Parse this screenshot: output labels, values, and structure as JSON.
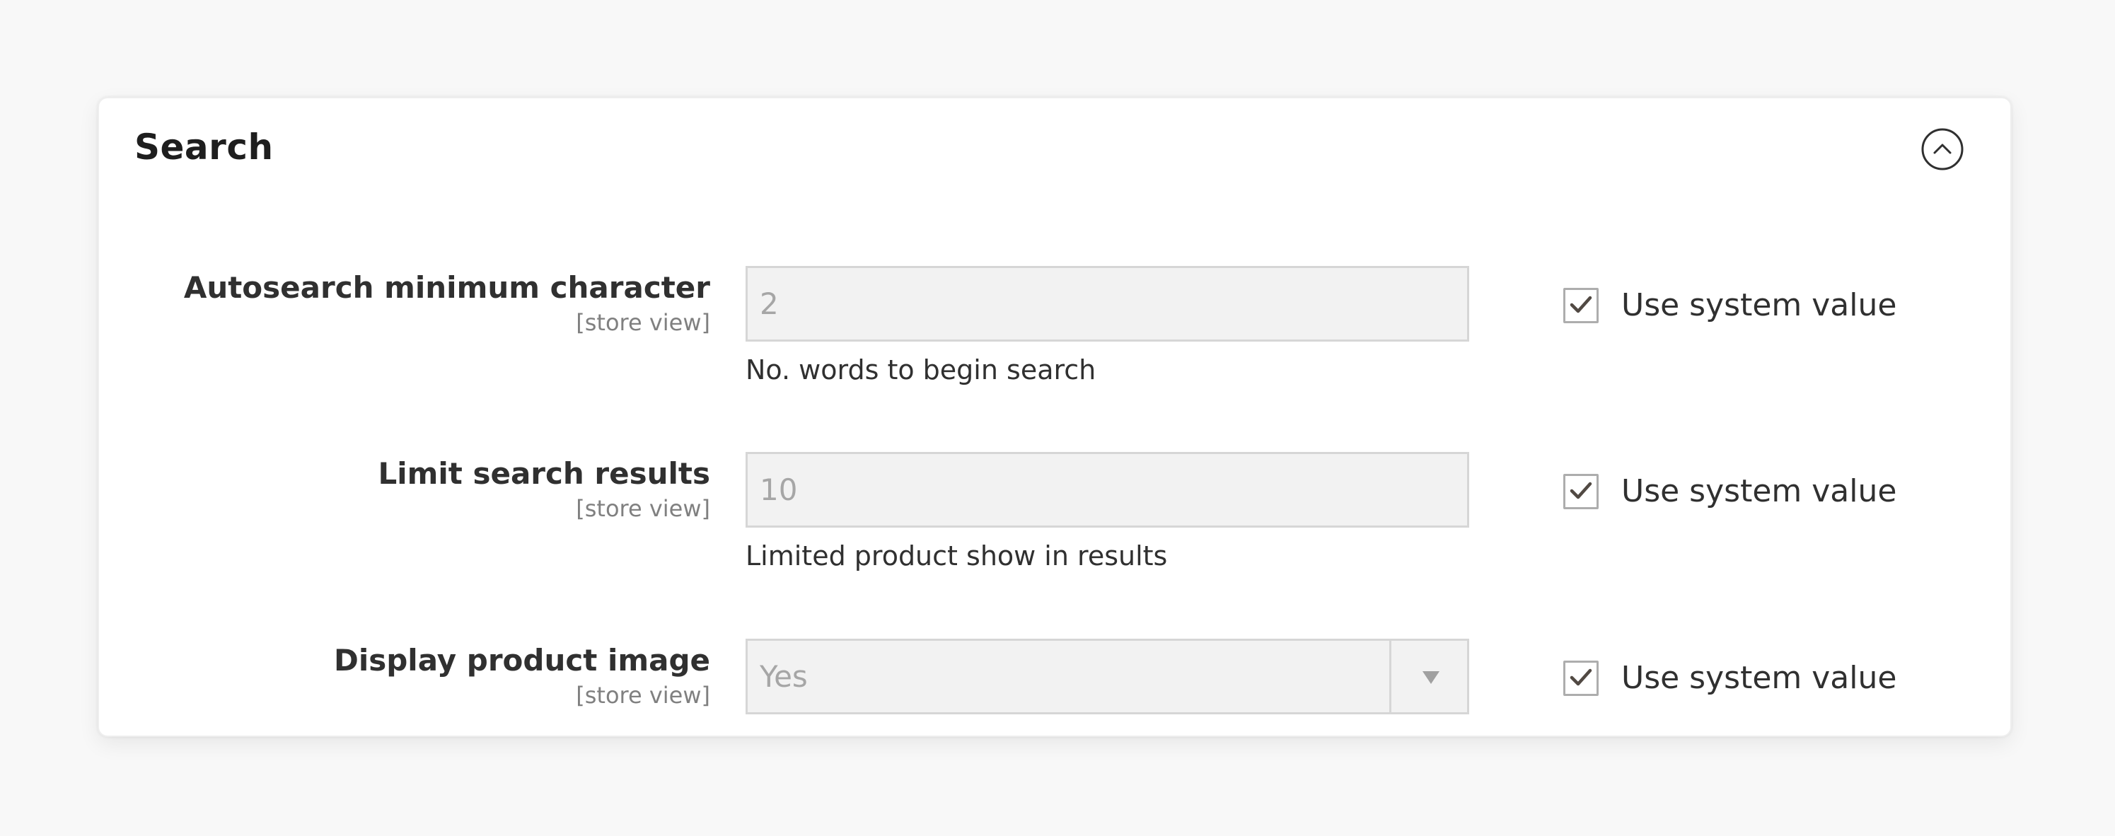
{
  "section": {
    "title": "Search",
    "collapse_icon": "chevron-up-circle-icon"
  },
  "fields": [
    {
      "label": "Autosearch minimum character",
      "scope": "[store view]",
      "type": "text",
      "value": "2",
      "hint": "No. words to begin search",
      "use_system_value_label": "Use system value",
      "use_system_value_checked": true,
      "disabled": true
    },
    {
      "label": "Limit search results",
      "scope": "[store view]",
      "type": "text",
      "value": "10",
      "hint": "Limited product show in results",
      "use_system_value_label": "Use system value",
      "use_system_value_checked": true,
      "disabled": true
    },
    {
      "label": "Display product image",
      "scope": "[store view]",
      "type": "select",
      "value": "Yes",
      "use_system_value_label": "Use system value",
      "use_system_value_checked": true,
      "disabled": true
    }
  ],
  "colors": {
    "page_background": "#f8f8f8",
    "card_background": "#ffffff",
    "disabled_field_background": "#f2f2f2",
    "field_border": "#d6d6d6",
    "text": "#303030",
    "muted_text": "#808080"
  }
}
